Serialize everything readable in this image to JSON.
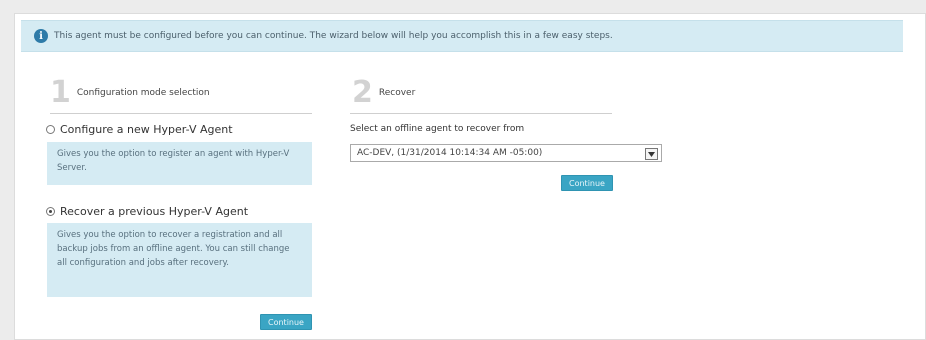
{
  "banner": {
    "icon": "info-icon",
    "text": "This agent must be configured before you can continue. The wizard below will help you accomplish this in a few easy steps."
  },
  "step1": {
    "number": "1",
    "label": "Configuration mode selection",
    "options": [
      {
        "label": "Configure a new Hyper-V Agent",
        "selected": false,
        "description": "Gives you the option to register an agent with Hyper-V Server."
      },
      {
        "label": "Recover a previous Hyper-V Agent",
        "selected": true,
        "description": "Gives you the option to recover a registration and all backup jobs from an offline agent. You can still change all configuration and jobs after recovery."
      }
    ],
    "continue_label": "Continue"
  },
  "step2": {
    "number": "2",
    "label": "Recover",
    "select_label": "Select an offline agent to recover from",
    "select_value": "AC-DEV, (1/31/2014 10:14:34 AM -05:00)",
    "continue_label": "Continue"
  },
  "colors": {
    "accent": "#3aa5c4",
    "info_bg": "#d5ebf3",
    "info_icon": "#2e7ba8"
  }
}
